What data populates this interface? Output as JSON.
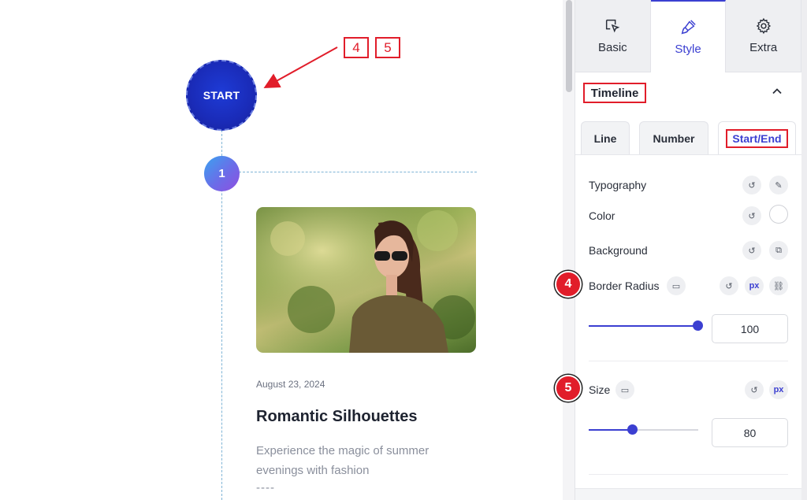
{
  "preview": {
    "start_label": "START",
    "item_number": "1",
    "card": {
      "date": "August 23, 2024",
      "title": "Romantic Silhouettes",
      "description": "Experience the magic of summer evenings with fashion",
      "separator": "----"
    },
    "callouts": [
      "4",
      "5"
    ]
  },
  "panel": {
    "tabs": [
      {
        "label": "Basic",
        "icon": "cursor-icon",
        "active": false
      },
      {
        "label": "Style",
        "icon": "brush-icon",
        "active": true
      },
      {
        "label": "Extra",
        "icon": "gear-icon",
        "active": false
      }
    ],
    "section_title": "Timeline",
    "subtabs": [
      {
        "label": "Line",
        "active": false
      },
      {
        "label": "Number",
        "active": false
      },
      {
        "label": "Start/End",
        "active": true
      }
    ],
    "rows": {
      "typography": "Typography",
      "color": "Color",
      "background": "Background",
      "border_radius": "Border Radius",
      "size": "Size"
    },
    "unit": "px",
    "border_radius_value": "100",
    "border_radius_fraction": 1.0,
    "size_value": "80",
    "size_fraction": 0.4,
    "badges": [
      "4",
      "5"
    ]
  },
  "colors": {
    "accent": "#3b3fd1",
    "callout_red": "#e11d2a",
    "start_circle": "#1a2bb8"
  }
}
